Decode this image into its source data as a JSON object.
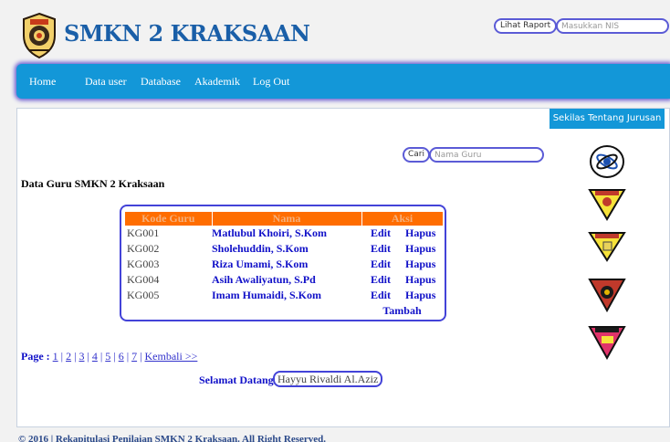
{
  "header": {
    "site_title": "SMKN 2 KRAKSAAN",
    "raport_button": "Lihat Raport",
    "nis_placeholder": "Masukkan NIS"
  },
  "nav": {
    "items": [
      "Home",
      "Data user",
      "Database",
      "Akademik",
      "Log Out"
    ]
  },
  "sidebar": {
    "sekilas_button": "Sekilas Tentang Jurusan",
    "department_icons": [
      "department-emblem-icon",
      "department-emblem-icon",
      "department-emblem-icon",
      "department-emblem-icon",
      "department-emblem-icon"
    ]
  },
  "search": {
    "button": "Cari",
    "placeholder": "Nama Guru"
  },
  "main": {
    "title": "Data Guru SMKN 2 Kraksaan",
    "table": {
      "headers": [
        "Kode Guru",
        "Nama",
        "Aksi"
      ],
      "rows": [
        {
          "kode": "KG001",
          "nama": "Matlubul Khoiri, S.Kom",
          "edit": "Edit",
          "hapus": "Hapus"
        },
        {
          "kode": "KG002",
          "nama": "Sholehuddin, S.Kom",
          "edit": "Edit",
          "hapus": "Hapus"
        },
        {
          "kode": "KG003",
          "nama": "Riza Umami, S.Kom",
          "edit": "Edit",
          "hapus": "Hapus"
        },
        {
          "kode": "KG004",
          "nama": "Asih Awaliyatun, S.Pd",
          "edit": "Edit",
          "hapus": "Hapus"
        },
        {
          "kode": "KG005",
          "nama": "Imam Humaidi, S.Kom",
          "edit": "Edit",
          "hapus": "Hapus"
        }
      ],
      "tambah": "Tambah"
    },
    "pagination": {
      "label": "Page :",
      "pages": [
        "1",
        "2",
        "3",
        "4",
        "5",
        "6",
        "7"
      ],
      "back": "Kembali >>"
    },
    "welcome_label": "Selamat Datang",
    "user_name": "Hayyu Rivaldi Al.Aziz"
  },
  "footer": {
    "text": "© 2016 | Rekapitulasi Penilaian SMKN 2 Kraksaan. All Right Reserved."
  },
  "colors": {
    "nav_bg": "#1397d8",
    "table_header": "#ff6d00",
    "link": "#1010c8",
    "title": "#1a5fa8"
  }
}
